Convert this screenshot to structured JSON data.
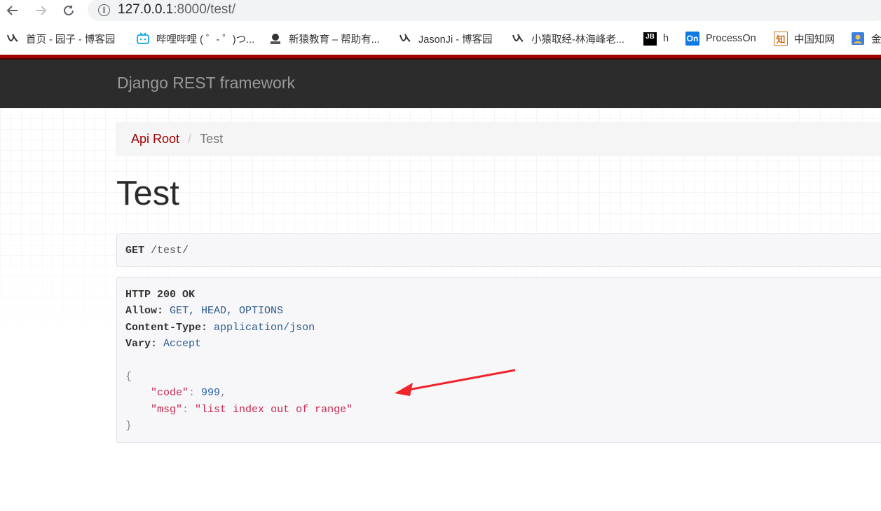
{
  "browser": {
    "url_host": "127.0.0.1",
    "url_rest": ":8000/test/",
    "bookmarks": [
      {
        "label": "首页 - 园子 - 博客园",
        "icon": "cnblogs-icon"
      },
      {
        "label": "哔哩哔哩 ( ゜- ゜)つ...",
        "icon": "bilibili-icon"
      },
      {
        "label": "新猿教育 – 帮助有...",
        "icon": "monkey-icon"
      },
      {
        "label": "JasonJi - 博客园",
        "icon": "cnblogs-icon"
      },
      {
        "label": "小猿取经-林海峰老...",
        "icon": "cnblogs-icon"
      },
      {
        "label": "h",
        "icon": "jetbrains-icon"
      },
      {
        "label": "ProcessOn",
        "icon": "processon-icon"
      },
      {
        "label": "中国知网",
        "icon": "cnki-icon"
      },
      {
        "label": "金",
        "icon": "profile-icon"
      }
    ]
  },
  "app": {
    "brand": "Django REST framework",
    "breadcrumb": {
      "root": "Api Root",
      "separator": "/",
      "current": "Test"
    },
    "title": "Test",
    "request": {
      "method": "GET",
      "path": "/test/"
    },
    "response": {
      "status": "HTTP 200 OK",
      "headers": [
        {
          "key": "Allow:",
          "value": "GET, HEAD, OPTIONS"
        },
        {
          "key": "Content-Type:",
          "value": "application/json"
        },
        {
          "key": "Vary:",
          "value": "Accept"
        }
      ],
      "body": {
        "open": "{",
        "code_key": "\"code\"",
        "code_val": "999",
        "msg_key": "\"msg\"",
        "msg_val": "\"list index out of range\"",
        "close": "}"
      }
    }
  },
  "colors": {
    "accent": "#a30000",
    "navbar": "#2c2c2c",
    "arrow": "#f0242b"
  }
}
